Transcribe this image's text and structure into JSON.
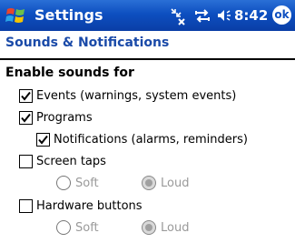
{
  "titlebar": {
    "app_title": "Settings",
    "clock": "8:42",
    "ok_label": "ok",
    "icons": [
      "start-flag-icon",
      "connectivity-icon",
      "sync-icon",
      "volume-icon"
    ]
  },
  "page": {
    "title": "Sounds & Notifications"
  },
  "section": {
    "heading": "Enable sounds for"
  },
  "options": {
    "events": {
      "label": "Events (warnings, system events)",
      "checked": true
    },
    "programs": {
      "label": "Programs",
      "checked": true
    },
    "notifications": {
      "label": "Notifications (alarms, reminders)",
      "checked": true
    },
    "screen_taps": {
      "label": "Screen taps",
      "checked": false,
      "soft": "Soft",
      "loud": "Loud",
      "selected": "Loud"
    },
    "hardware_buttons": {
      "label": "Hardware buttons",
      "checked": false,
      "soft": "Soft",
      "loud": "Loud",
      "selected": "Loud"
    }
  },
  "colors": {
    "titlebar": "#0d4fc0",
    "header_text": "#1a4aa8",
    "disabled_text": "#9a9a9a"
  }
}
